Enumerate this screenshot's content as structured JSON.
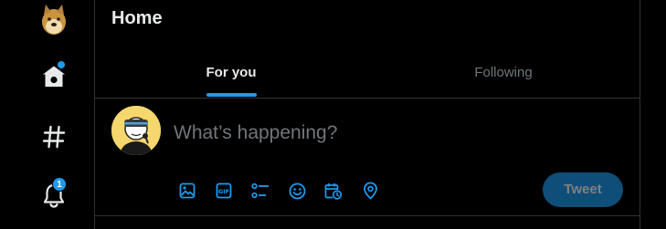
{
  "nav": {
    "items": [
      {
        "name": "profile-avatar",
        "icon": "doge-avatar-icon"
      },
      {
        "name": "home",
        "icon": "home-icon",
        "has_dot": true
      },
      {
        "name": "explore",
        "icon": "hashtag-icon"
      },
      {
        "name": "notifications",
        "icon": "bell-icon",
        "badge": "1"
      }
    ]
  },
  "header": {
    "title": "Home"
  },
  "tabs": [
    {
      "label": "For you",
      "active": true
    },
    {
      "label": "Following",
      "active": false
    }
  ],
  "compose": {
    "placeholder": "What’s happening?",
    "value": "",
    "tools": [
      "media-icon",
      "gif-icon",
      "poll-icon",
      "emoji-icon",
      "schedule-icon",
      "location-icon"
    ],
    "tweet_label": "Tweet"
  },
  "colors": {
    "background": "#000000",
    "accent": "#1d9bf0",
    "border": "#2f3336",
    "text": "#e7e9ea",
    "muted": "#71767b",
    "tweet_disabled": "#0f4e78"
  }
}
